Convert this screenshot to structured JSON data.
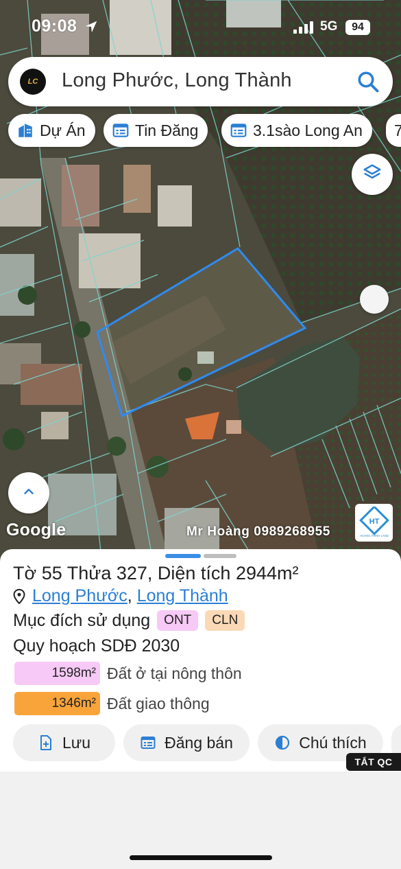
{
  "status_bar": {
    "time": "09:08",
    "network": "5G",
    "battery": "94"
  },
  "search": {
    "logo_text": "LC",
    "query": "Long Phước, Long Thành"
  },
  "chips": [
    {
      "label": "Dự Án",
      "icon": "building-icon"
    },
    {
      "label": "Tin Đăng",
      "icon": "listing-icon"
    },
    {
      "label": "3.1sào Long An",
      "icon": "listing-icon"
    },
    {
      "label": "7",
      "icon": "none"
    }
  ],
  "map": {
    "attribution": "Google",
    "watermark": "Mr Hoàng 0989268955",
    "brand_logo_text": "HOANG THINH LAND",
    "parcel_outline_color": "#2f8bf0"
  },
  "sheet": {
    "title": "Tờ 55 Thửa 327, Diện tích 2944m²",
    "address": {
      "ward": "Long Phước",
      "separator": ", ",
      "district": "Long Thành"
    },
    "purpose_label": "Mục đích sử dụng",
    "purpose_badges": [
      {
        "code": "ONT",
        "color": "#f7c9f6"
      },
      {
        "code": "CLN",
        "color": "#fbd9b6"
      }
    ],
    "plan_label": "Quy hoạch SDĐ 2030",
    "zones": [
      {
        "area": "1598m²",
        "label": "Đất ở tại nông thôn",
        "color": "#f7c9f6"
      },
      {
        "area": "1346m²",
        "label": "Đất giao thông",
        "color": "#f8a43a"
      }
    ],
    "actions": [
      {
        "label": "Lưu",
        "icon": "save-add-icon"
      },
      {
        "label": "Đăng bán",
        "icon": "listing-icon"
      },
      {
        "label": "Chú thích",
        "icon": "legend-icon"
      }
    ]
  },
  "ad_toggle": "TẮT QC"
}
